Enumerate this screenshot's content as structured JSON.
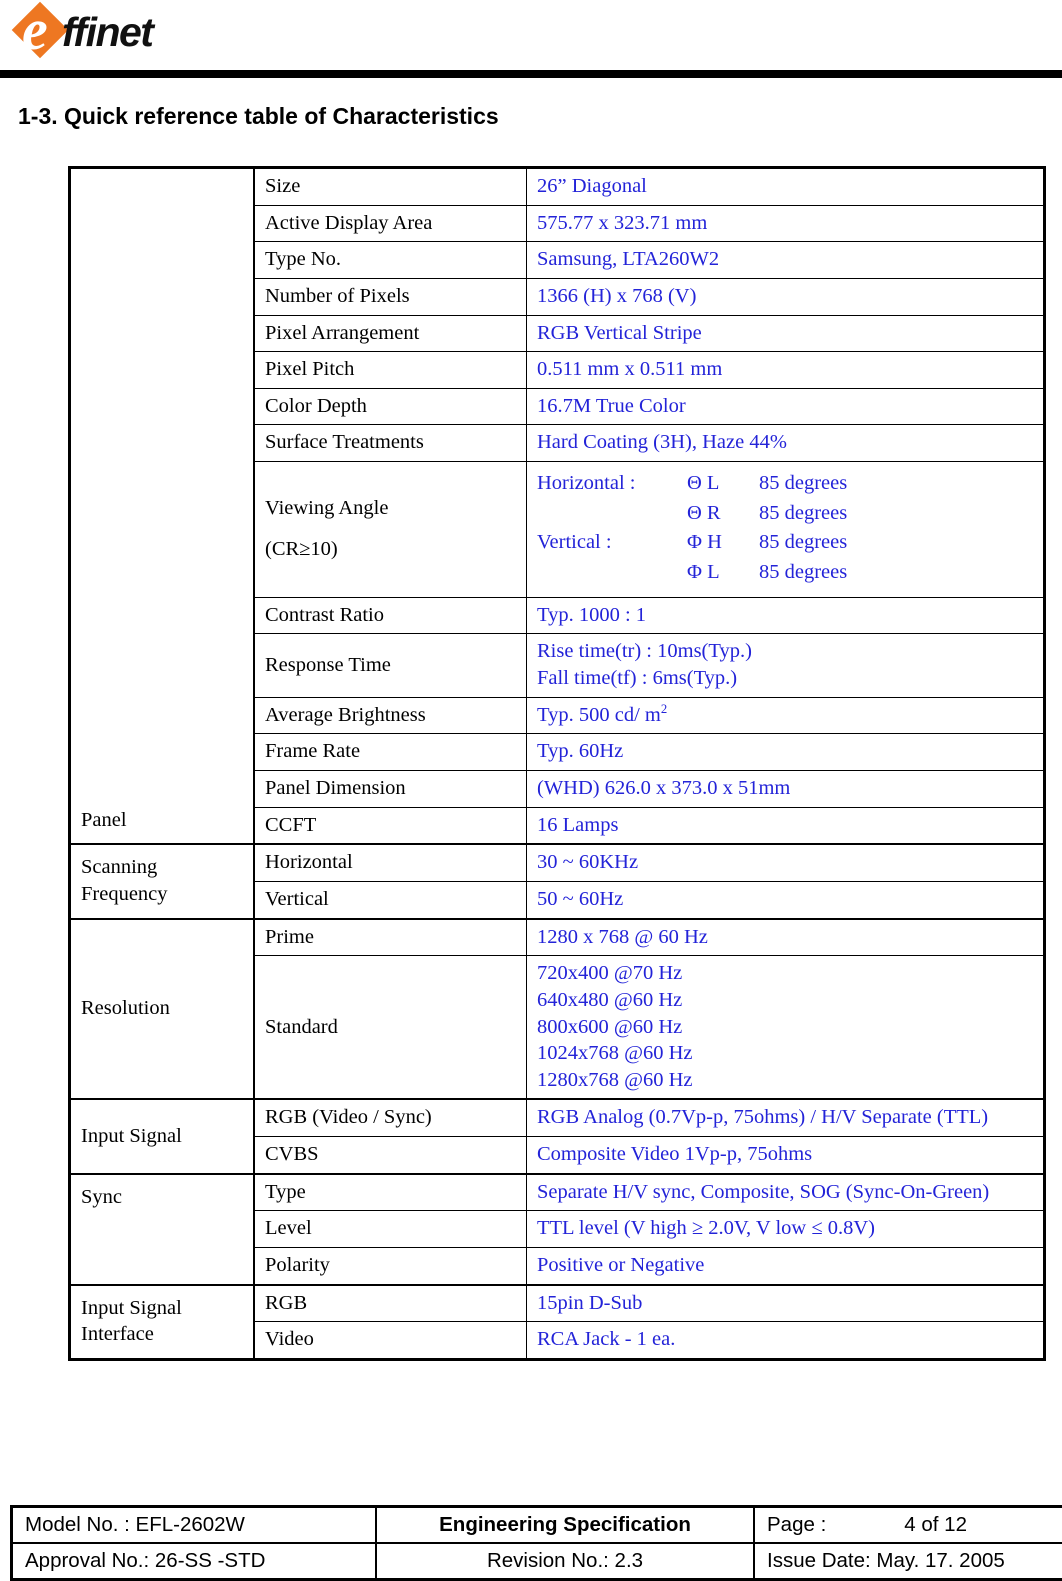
{
  "header": {
    "logo_mark": "orange-diamond",
    "logo_letter": "e",
    "logo_text": "ffinet"
  },
  "page_title": "1-3. Quick reference table of Characteristics",
  "colors": {
    "value_blue": "#2323D8",
    "logo_orange": "#EE7722",
    "rule_black": "#000000"
  },
  "spec_table": {
    "groups": [
      {
        "name": "Panel",
        "align": "bottom",
        "rows": [
          {
            "label": "Size",
            "value": "26”  Diagonal"
          },
          {
            "label": "Active Display Area",
            "value": " 575.77 x 323.71 mm"
          },
          {
            "label": "Type No.",
            "value": "Samsung, LTA260W2"
          },
          {
            "label": "Number of Pixels",
            "value": "1366 (H) x 768 (V)"
          },
          {
            "label": "Pixel Arrangement",
            "value": "RGB Vertical Stripe"
          },
          {
            "label": "Pixel Pitch",
            "value": "0.511 mm x 0.511 mm"
          },
          {
            "label": "Color Depth",
            "value": "16.7M True Color"
          },
          {
            "label": "Surface Treatments",
            "value": "Hard Coating (3H), Haze 44%"
          },
          {
            "label": "Viewing Angle",
            "label_line2": "(CR≥10)",
            "viewing_angle": [
              {
                "axis": "Horizontal :",
                "symbol": "Θ L",
                "value": "85 degrees"
              },
              {
                "axis": "",
                "symbol": "Θ R",
                "value": "85 degrees"
              },
              {
                "axis": "Vertical :",
                "symbol": "Φ H",
                "value": "85 degrees"
              },
              {
                "axis": "",
                "symbol": "Φ L",
                "value": "85 degrees"
              }
            ]
          },
          {
            "label": "Contrast Ratio",
            "value": "Typ. 1000 : 1"
          },
          {
            "label": "Response Time",
            "value": "Rise time(tr) : 10ms(Typ.)\nFall time(tf) : 6ms(Typ.)"
          },
          {
            "label": "Average Brightness",
            "value_html_prefix": "Typ.  500 cd/ m",
            "value_sup": "2"
          },
          {
            "label": "Frame Rate",
            "value": "Typ. 60Hz"
          },
          {
            "label": "Panel Dimension",
            "value": "(WHD) 626.0 x 373.0 x 51mm"
          },
          {
            "label": "CCFT",
            "value": "16 Lamps"
          }
        ]
      },
      {
        "name": "Scanning\nFrequency",
        "align": "middle",
        "rows": [
          {
            "label": "Horizontal",
            "value": "30 ~ 60KHz"
          },
          {
            "label": "Vertical",
            "value": "50 ~ 60Hz"
          }
        ]
      },
      {
        "name": "Resolution",
        "align": "middle",
        "rows": [
          {
            "label": "Prime",
            "value": "1280 x 768 @ 60 Hz"
          },
          {
            "label": "Standard",
            "value": "720x400 @70 Hz\n640x480 @60 Hz\n800x600 @60 Hz\n1024x768 @60 Hz\n1280x768 @60 Hz"
          }
        ]
      },
      {
        "name": "Input Signal",
        "align": "middle",
        "rows": [
          {
            "label": "RGB (Video / Sync)",
            "value": "RGB Analog (0.7Vp-p, 75ohms) / H/V Separate (TTL)"
          },
          {
            "label": "CVBS",
            "value": "Composite Video 1Vp-p, 75ohms"
          }
        ]
      },
      {
        "name": "Sync",
        "align": "top",
        "rows": [
          {
            "label": "Type",
            "value": "Separate H/V sync, Composite, SOG (Sync-On-Green)"
          },
          {
            "label": "Level",
            "value": "TTL level  (V high ≥ 2.0V, V low ≤ 0.8V)"
          },
          {
            "label": "Polarity",
            "value": "Positive or Negative"
          }
        ]
      },
      {
        "name": "Input Signal\nInterface",
        "align": "top",
        "rows": [
          {
            "label": "RGB",
            "value": "15pin D-Sub"
          },
          {
            "label": "Video",
            "value": "RCA Jack - 1 ea."
          }
        ]
      }
    ]
  },
  "footer": {
    "model_no": "Model No. : EFL-2602W",
    "approval_no": "Approval No.: 26-SS -STD",
    "doc_title": "Engineering  Specification",
    "revision_no": "Revision No.: 2.3",
    "page_label": "Page :",
    "page_value": "4 of  12",
    "issue_date": "Issue Date: May. 17. 2005"
  }
}
